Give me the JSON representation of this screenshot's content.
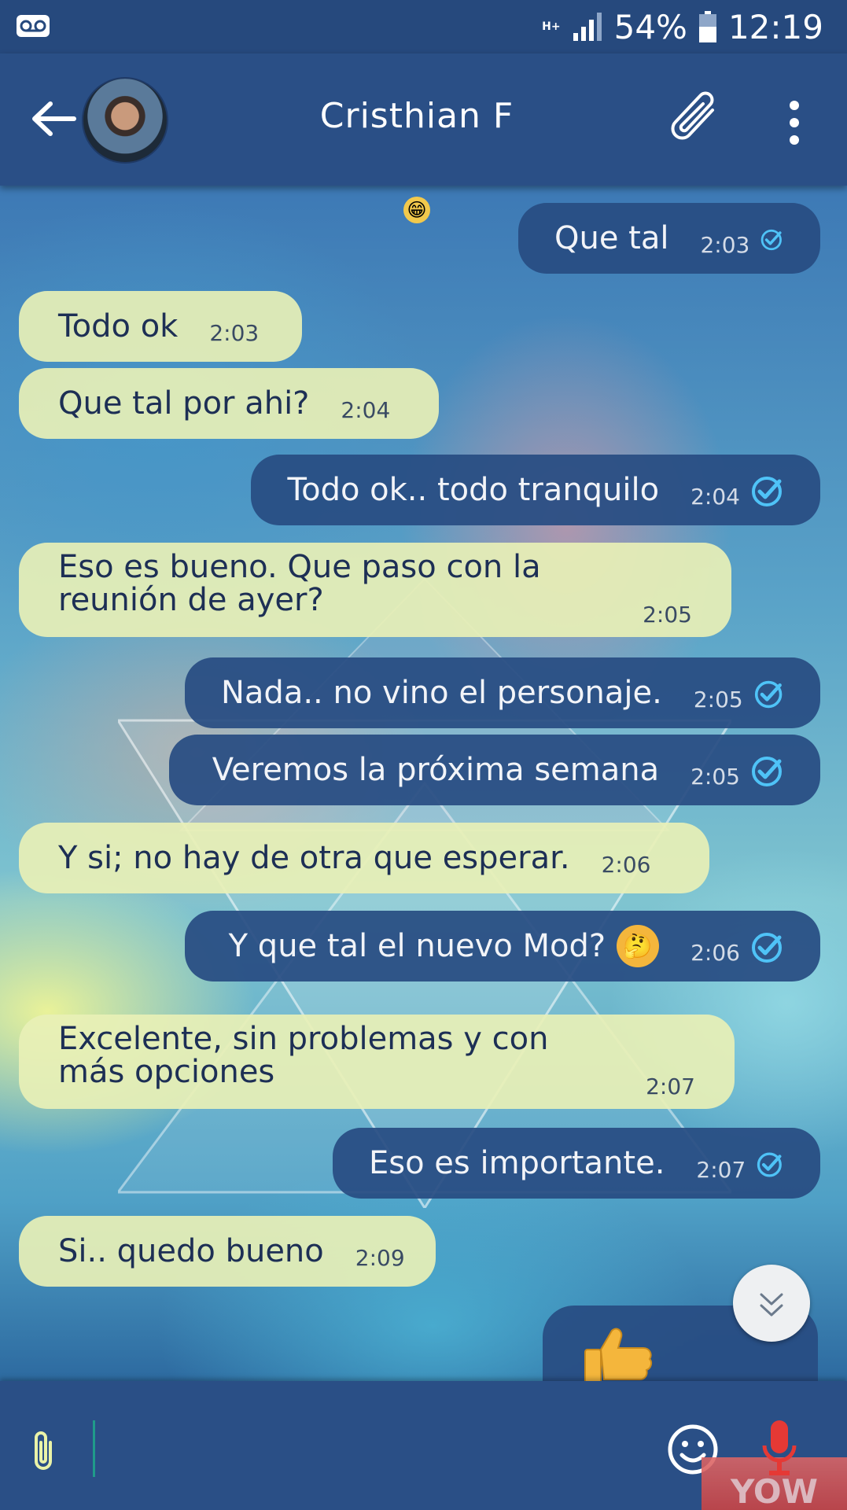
{
  "status_bar": {
    "network": "H+",
    "battery": "54%",
    "time": "12:19",
    "icons": [
      "voicemail-icon",
      "network-icon",
      "signal-icon",
      "battery-icon"
    ]
  },
  "header": {
    "contact_name": "Cristhian F",
    "icons": [
      "back-arrow-icon",
      "avatar",
      "paperclip-icon",
      "more-vertical-icon"
    ]
  },
  "messages": [
    {
      "dir": "out",
      "text": "Que tal",
      "time": "2:03",
      "read": true
    },
    {
      "dir": "in",
      "text": "Todo ok",
      "time": "2:03"
    },
    {
      "dir": "in",
      "text": "Que tal por ahi?",
      "time": "2:04"
    },
    {
      "dir": "out",
      "text": "Todo ok.. todo tranquilo",
      "time": "2:04",
      "read": true
    },
    {
      "dir": "in",
      "text": "Eso es bueno. Que paso con la reunión de ayer?",
      "time": "2:05"
    },
    {
      "dir": "out",
      "text": "Nada.. no vino el personaje.",
      "time": "2:05",
      "read": true
    },
    {
      "dir": "out",
      "text": "Veremos la próxima semana",
      "time": "2:05",
      "read": true
    },
    {
      "dir": "in",
      "text": "Y si; no hay de otra que esperar.",
      "time": "2:06"
    },
    {
      "dir": "out",
      "text": "Y que tal el nuevo Mod?",
      "time": "2:06",
      "read": true,
      "emoji": "thinking-face"
    },
    {
      "dir": "in",
      "text": "Excelente, sin problemas y con más opciones",
      "time": "2:07"
    },
    {
      "dir": "out",
      "text": "Eso es importante.",
      "time": "2:07",
      "read": true
    },
    {
      "dir": "in",
      "text": "Si.. quedo bueno",
      "time": "2:09"
    },
    {
      "dir": "out",
      "emoji": "thumbs-up"
    }
  ],
  "input_bar": {
    "placeholder": "",
    "icons": [
      "paperclip-icon",
      "emoji-icon",
      "microphone-icon"
    ]
  },
  "watermark": "YOW",
  "colors": {
    "header": "#2a4f86",
    "outgoing_bubble": "#284c82",
    "incoming_bubble": "#e8f0b6",
    "check": "#4fc3f7",
    "mic": "#e53935"
  }
}
